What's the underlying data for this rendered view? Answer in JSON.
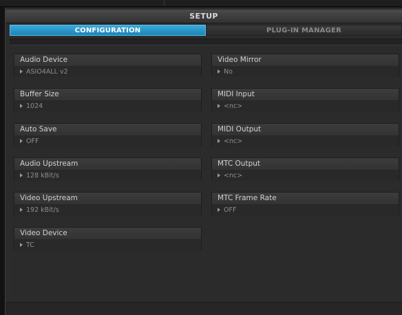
{
  "window": {
    "title": "SETUP"
  },
  "tabs": [
    {
      "label": "CONFIGURATION",
      "active": true
    },
    {
      "label": "PLUG-IN MANAGER",
      "active": false
    }
  ],
  "settings_left": [
    {
      "label": "Audio Device",
      "value": "ASIO4ALL v2"
    },
    {
      "label": "Buffer Size",
      "value": "1024"
    },
    {
      "label": "Auto Save",
      "value": "OFF"
    },
    {
      "label": "Audio Upstream",
      "value": "128 kBit/s"
    },
    {
      "label": "Video Upstream",
      "value": "192 kBit/s"
    },
    {
      "label": "Video Device",
      "value": "TC"
    }
  ],
  "settings_right": [
    {
      "label": "Video Mirror",
      "value": "No"
    },
    {
      "label": "MIDI Input",
      "value": "<nc>"
    },
    {
      "label": "MIDI Output",
      "value": "<nc>"
    },
    {
      "label": "MTC Output",
      "value": "<nc>"
    },
    {
      "label": "MTC Frame Rate",
      "value": "OFF"
    }
  ],
  "colors": {
    "accent": "#1b85b8",
    "panel": "#2f2f2f",
    "background": "#2b2b2b",
    "text": "#d2d2d2",
    "value_text": "#8e8e8e"
  },
  "icons": {
    "value_arrow": "triangle-right-icon"
  }
}
